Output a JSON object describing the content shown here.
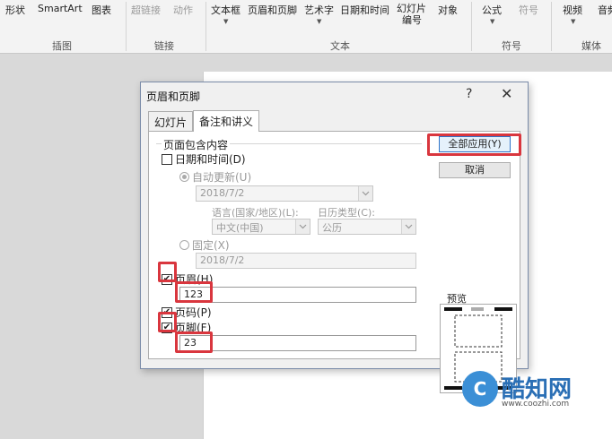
{
  "ribbon": {
    "items": [
      {
        "label": "形状",
        "dim": false
      },
      {
        "label": "SmartArt",
        "dim": false
      },
      {
        "label": "图表",
        "dim": false
      },
      {
        "label": "超链接",
        "dim": true
      },
      {
        "label": "动作",
        "dim": true
      },
      {
        "label": "文本框",
        "dim": false
      },
      {
        "label": "页眉和页脚",
        "dim": false
      },
      {
        "label": "艺术字",
        "dim": false
      },
      {
        "label": "日期和时间",
        "dim": false
      },
      {
        "label": "幻灯片",
        "label2": "编号",
        "dim": false
      },
      {
        "label": "对象",
        "dim": false
      },
      {
        "label": "公式",
        "dim": false
      },
      {
        "label": "符号",
        "dim": true
      },
      {
        "label": "视频",
        "dim": false
      },
      {
        "label": "音频",
        "dim": false
      }
    ],
    "groups": [
      "插图",
      "链接",
      "文本",
      "符号",
      "媒体"
    ]
  },
  "dialog": {
    "title": "页眉和页脚",
    "help": "?",
    "close": "✕",
    "tabs": [
      "幻灯片",
      "备注和讲义"
    ],
    "section_label": "页面包含内容",
    "date_time_label": "日期和时间(D)",
    "auto_update_label": "自动更新(U)",
    "date_value": "2018/7/2",
    "language_label": "语言(国家/地区)(L):",
    "calendar_label": "日历类型(C):",
    "language_value": "中文(中国)",
    "calendar_value": "公历",
    "fixed_label": "固定(X)",
    "fixed_value": "2018/7/2",
    "header_label": "页眉(H)",
    "header_value": "123",
    "page_number_label": "页码(P)",
    "footer_label": "页脚(F)",
    "footer_value": "23",
    "apply_all_button": "全部应用(Y)",
    "cancel_button": "取消",
    "preview_label": "预览",
    "checkbox_state": {
      "date_time": false,
      "header": true,
      "page_number": true,
      "footer": true
    }
  },
  "watermark": {
    "icon_letter": "C",
    "text": "酷知网",
    "url": "www.coozhi.com"
  },
  "colors": {
    "highlight": "#d9363e",
    "accent": "#2f74c9"
  }
}
